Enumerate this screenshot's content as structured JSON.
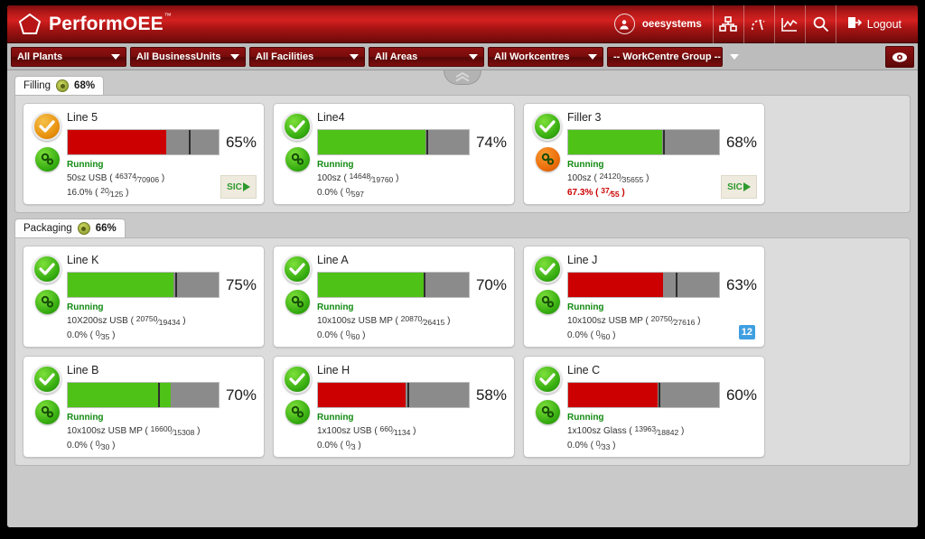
{
  "header": {
    "brand": "PerformOEE",
    "brand_tm": "™",
    "username": "oeesystems",
    "logout_label": "Logout",
    "icons": [
      "org-chart-icon",
      "gauge-icon",
      "trend-chart-icon",
      "search-icon"
    ],
    "brand_color": "#c41a1a"
  },
  "filters": [
    {
      "label": "All Plants",
      "name": "filter-all-plants"
    },
    {
      "label": "All BusinessUnits",
      "name": "filter-all-businessunits"
    },
    {
      "label": "All Facilities",
      "name": "filter-all-facilities"
    },
    {
      "label": "All Areas",
      "name": "filter-all-areas"
    },
    {
      "label": "All Workcentres",
      "name": "filter-all-workcentres"
    },
    {
      "label": "-- WorkCentre Group --",
      "name": "filter-workcentre-group"
    }
  ],
  "groups": [
    {
      "tab_label": "Filling",
      "tab_pct": "68%",
      "cards": [
        {
          "title": "Line 5",
          "pct": "65%",
          "fill": 65,
          "fill_color": "red",
          "target": 80,
          "status": "amber",
          "gears": "green",
          "state": "Running",
          "metric1_prefix": "50sz USB (",
          "metric1_num": "46374",
          "metric1_den": "70906",
          "metric1_suffix": ")",
          "metric2_prefix": "16.0% (",
          "metric2_num": "20",
          "metric2_den": "125",
          "metric2_suffix": ")",
          "metric2_alert": false,
          "stamp": "SIC",
          "badge": null
        },
        {
          "title": "Line4",
          "pct": "74%",
          "fill": 71,
          "fill_color": "green",
          "target": 72,
          "status": "green",
          "gears": "green",
          "state": "Running",
          "metric1_prefix": "100sz (",
          "metric1_num": "14648",
          "metric1_den": "19760",
          "metric1_suffix": ")",
          "metric2_prefix": "0.0% (",
          "metric2_num": "0",
          "metric2_den": "597",
          "metric2_suffix": "",
          "metric2_alert": false,
          "stamp": null,
          "badge": null
        },
        {
          "title": "Filler 3",
          "pct": "68%",
          "fill": 62,
          "fill_color": "green",
          "target": 63,
          "status": "green",
          "gears": "orange",
          "state": "Running",
          "metric1_prefix": "100sz (",
          "metric1_num": "24120",
          "metric1_den": "35655",
          "metric1_suffix": ")",
          "metric2_prefix": "67.3% (",
          "metric2_num": "37",
          "metric2_den": "55",
          "metric2_suffix": ")",
          "metric2_alert": true,
          "stamp": "SIC",
          "badge": null
        }
      ]
    },
    {
      "tab_label": "Packaging",
      "tab_pct": "66%",
      "cards": [
        {
          "title": "Line K",
          "pct": "75%",
          "fill": 70,
          "fill_color": "green",
          "target": 71,
          "status": "green",
          "gears": "green",
          "state": "Running",
          "metric1_prefix": "10X200sz USB (",
          "metric1_num": "20750",
          "metric1_den": "19434",
          "metric1_suffix": ")",
          "metric2_prefix": "0.0% (",
          "metric2_num": "0",
          "metric2_den": "35",
          "metric2_suffix": ")",
          "metric2_alert": false,
          "stamp": null,
          "badge": null
        },
        {
          "title": "Line A",
          "pct": "70%",
          "fill": 70,
          "fill_color": "green",
          "target": 70,
          "status": "green",
          "gears": "green",
          "state": "Running",
          "metric1_prefix": "10x100sz USB MP (",
          "metric1_num": "20870",
          "metric1_den": "26415",
          "metric1_suffix": ")",
          "metric2_prefix": "0.0% (",
          "metric2_num": "0",
          "metric2_den": "60",
          "metric2_suffix": ")",
          "metric2_alert": false,
          "stamp": null,
          "badge": null
        },
        {
          "title": "Line J",
          "pct": "63%",
          "fill": 63,
          "fill_color": "red",
          "target": 71,
          "status": "green",
          "gears": "green",
          "state": "Running",
          "metric1_prefix": "10x100sz USB MP (",
          "metric1_num": "20750",
          "metric1_den": "27616",
          "metric1_suffix": ")",
          "metric2_prefix": "0.0% (",
          "metric2_num": "0",
          "metric2_den": "60",
          "metric2_suffix": ")",
          "metric2_alert": false,
          "stamp": null,
          "badge": "12"
        },
        {
          "title": "Line B",
          "pct": "70%",
          "fill": 68,
          "fill_color": "green",
          "target": 60,
          "status": "green",
          "gears": "green",
          "state": "Running",
          "metric1_prefix": "10x100sz USB MP (",
          "metric1_num": "16600",
          "metric1_den": "15308",
          "metric1_suffix": ")",
          "metric2_prefix": "0.0% (",
          "metric2_num": "0",
          "metric2_den": "30",
          "metric2_suffix": ")",
          "metric2_alert": false,
          "stamp": null,
          "badge": null
        },
        {
          "title": "Line H",
          "pct": "58%",
          "fill": 58,
          "fill_color": "red",
          "target": 59,
          "status": "green",
          "gears": "green",
          "state": "Running",
          "metric1_prefix": "1x100sz USB (",
          "metric1_num": "660",
          "metric1_den": "1134",
          "metric1_suffix": ")",
          "metric2_prefix": "0.0% (",
          "metric2_num": "0",
          "metric2_den": "3",
          "metric2_suffix": ")",
          "metric2_alert": false,
          "stamp": null,
          "badge": null
        },
        {
          "title": "Line C",
          "pct": "60%",
          "fill": 59,
          "fill_color": "red",
          "target": 60,
          "status": "green",
          "gears": "green",
          "state": "Running",
          "metric1_prefix": "1x100sz Glass (",
          "metric1_num": "13963",
          "metric1_den": "18842",
          "metric1_suffix": ")",
          "metric2_prefix": "0.0% (",
          "metric2_num": "0",
          "metric2_den": "33",
          "metric2_suffix": ")",
          "metric2_alert": false,
          "stamp": null,
          "badge": null
        }
      ]
    }
  ]
}
